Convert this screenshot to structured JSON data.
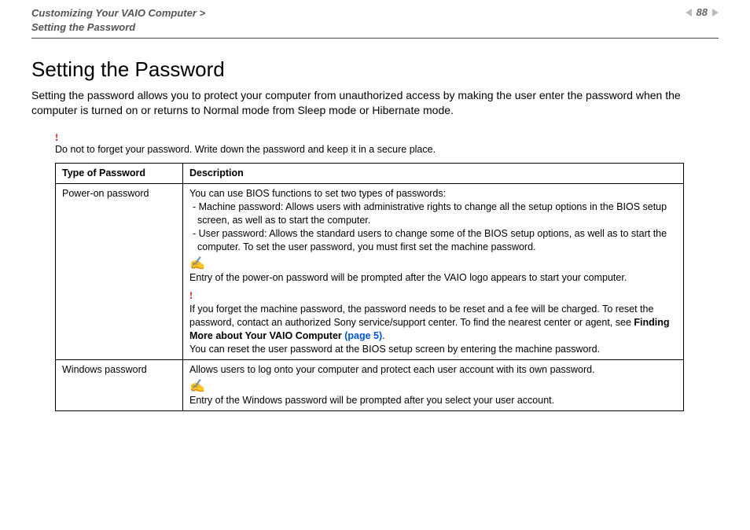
{
  "header": {
    "breadcrumb_line1": "Customizing Your VAIO Computer >",
    "breadcrumb_line2": "Setting the Password",
    "page_number": "88"
  },
  "title": "Setting the Password",
  "intro": "Setting the password allows you to protect your computer from unauthorized access by making the user enter the password when the computer is turned on or returns to Normal mode from Sleep mode or Hibernate mode.",
  "top_warning": "Do not to forget your password. Write down the password and keep it in a secure place.",
  "table": {
    "header_col1": "Type of Password",
    "header_col2": "Description",
    "rows": [
      {
        "type": "Power-on password",
        "desc_intro": "You can use BIOS functions to set two types of passwords:",
        "bullet1": "- Machine password: Allows users with administrative rights to change all the setup options in the BIOS setup screen, as well as to start the computer.",
        "bullet2": "- User password: Allows the standard users to change some of the BIOS setup options, as well as to start the computer. To set the user password, you must first set the machine password.",
        "note1": "Entry of the power-on password will be prompted after the VAIO logo appears to start your computer.",
        "warn_text": "If you forget the machine password, the password needs to be reset and a fee will be charged. To reset the password, contact an authorized Sony service/support center. To find the nearest center or agent, see ",
        "warn_bold": "Finding More about Your VAIO Computer ",
        "warn_link": "(page 5)",
        "warn_after": ".",
        "reset_user": "You can reset the user password at the BIOS setup screen by entering the machine password."
      },
      {
        "type": "Windows password",
        "desc_intro": "Allows users to log onto your computer and protect each user account with its own password.",
        "note1": "Entry of the Windows password will be prompted after you select your user account."
      }
    ]
  }
}
